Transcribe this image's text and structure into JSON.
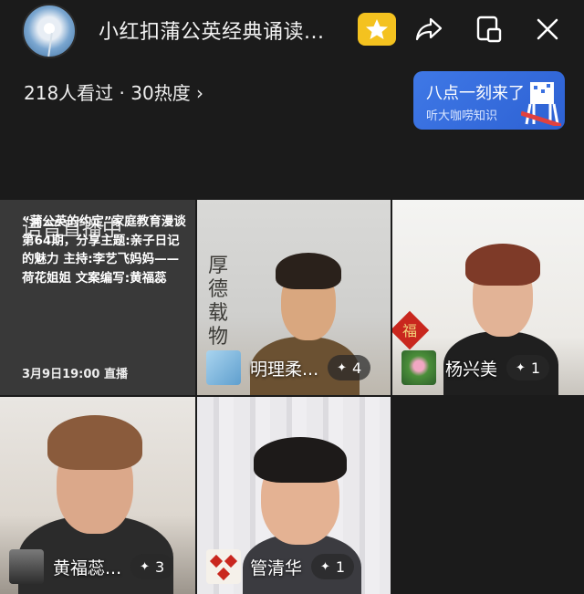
{
  "header": {
    "title": "小红扣蒲公英经典诵读...",
    "stats": "218人看过 · 30热度 ›"
  },
  "promo": {
    "line1": "八点一刻来了",
    "line2": "听大咖唠知识"
  },
  "info_tile": {
    "overlay": "语音直播中",
    "description": "“蒲公英的约定”家庭教育漫谈第64期，分享主题:亲子日记的魅力 主持:李艺飞妈妈——荷花姐姐 文案编写:黄福蕊",
    "time": "3月9日19:00 直播"
  },
  "participants": [
    {
      "name": "明理柔...",
      "likes": "4"
    },
    {
      "name": "杨兴美",
      "likes": "1"
    },
    {
      "name": "黄福蕊...",
      "likes": "3"
    },
    {
      "name": "管清华",
      "likes": "1"
    }
  ],
  "decor": {
    "calligraphy": "厚德载物",
    "fu": "福"
  },
  "colors": {
    "background": "#1b1b1b",
    "vip_badge": "#f4c21f",
    "promo_blue": "#3a70e0"
  }
}
